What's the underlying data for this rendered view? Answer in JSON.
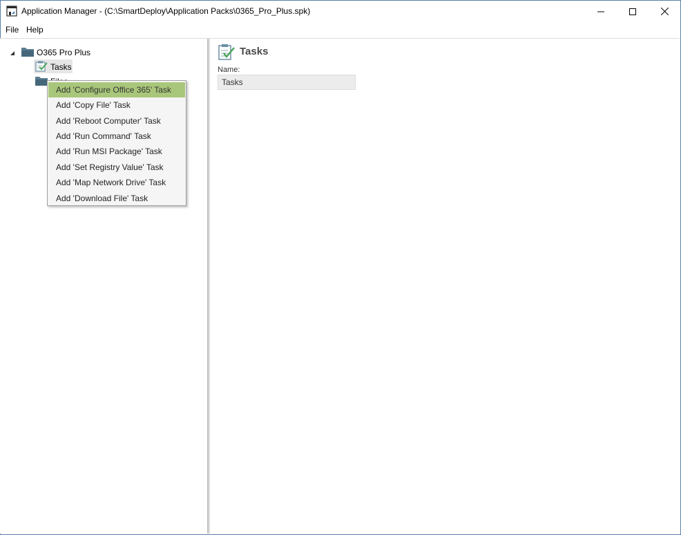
{
  "window": {
    "title": "Application Manager - (C:\\SmartDeploy\\Application Packs\\0365_Pro_Plus.spk)"
  },
  "menubar": {
    "items": [
      {
        "label": "File"
      },
      {
        "label": "Help"
      }
    ]
  },
  "tree": {
    "root": {
      "label": "O365 Pro Plus",
      "icon": "folder-icon",
      "expanded": true
    },
    "children": [
      {
        "label": "Tasks",
        "icon": "tasks-icon",
        "selected": true
      },
      {
        "label": "Files",
        "icon": "folder-icon"
      }
    ]
  },
  "context_menu": {
    "items": [
      {
        "label": "Add 'Configure Office 365' Task",
        "highlighted": true
      },
      {
        "label": "Add 'Copy File' Task"
      },
      {
        "label": "Add 'Reboot Computer' Task"
      },
      {
        "label": "Add 'Run Command' Task"
      },
      {
        "label": "Add 'Run MSI Package' Task"
      },
      {
        "label": "Add 'Set Registry Value' Task"
      },
      {
        "label": "Add 'Map Network Drive' Task"
      },
      {
        "label": "Add 'Download File' Task"
      }
    ],
    "highlight_color": "#a9c77a"
  },
  "detail": {
    "title": "Tasks",
    "name_label": "Name:",
    "name_value": "Tasks"
  },
  "colors": {
    "folder": "#5a7d91",
    "accent_green": "#a9c77a"
  }
}
